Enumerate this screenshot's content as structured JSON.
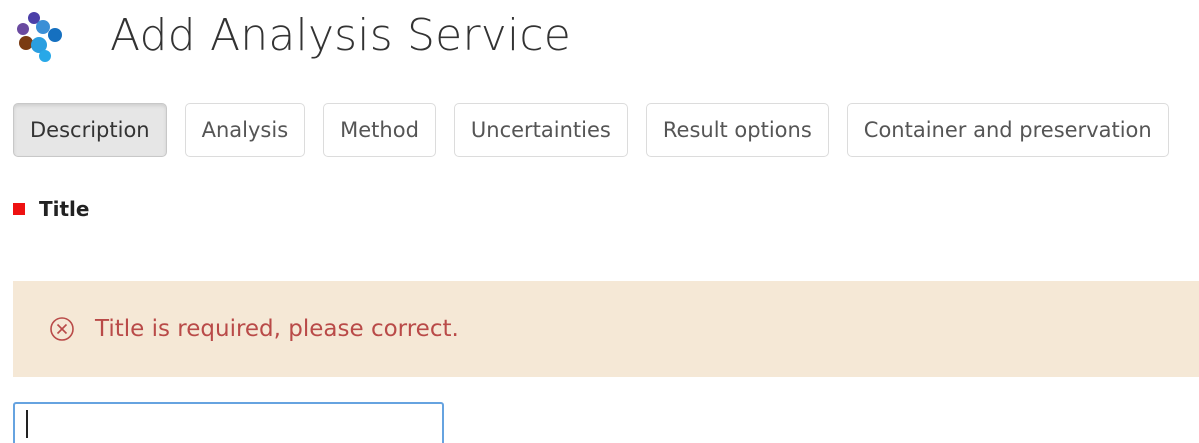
{
  "header": {
    "logo_icon": "molecule-logo-icon",
    "title": "Add Analysis Service"
  },
  "tabs": [
    {
      "label": "Description",
      "active": true
    },
    {
      "label": "Analysis",
      "active": false
    },
    {
      "label": "Method",
      "active": false
    },
    {
      "label": "Uncertainties",
      "active": false
    },
    {
      "label": "Result options",
      "active": false
    },
    {
      "label": "Container and preservation",
      "active": false
    }
  ],
  "field": {
    "label": "Title",
    "required": true,
    "value": ""
  },
  "alert": {
    "icon": "circle-x-icon",
    "message": "Title is required, please correct."
  },
  "colors": {
    "required_marker": "#ee1111",
    "alert_background": "#f5e8d6",
    "alert_text": "#b94a48",
    "input_focus_border": "#66a3e0"
  }
}
